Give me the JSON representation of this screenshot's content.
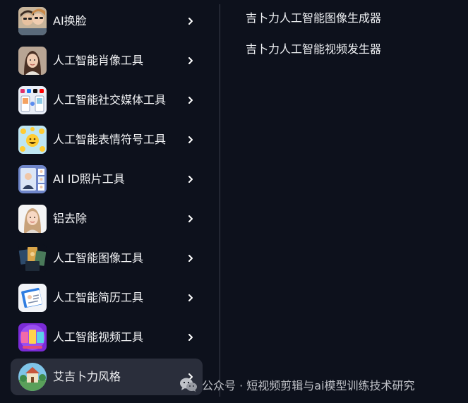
{
  "menu": {
    "items": [
      {
        "label": "AI换脸",
        "icon": "face-swap-thumbnail-icon"
      },
      {
        "label": "人工智能肖像工具",
        "icon": "portrait-thumbnail-icon"
      },
      {
        "label": "人工智能社交媒体工具",
        "icon": "social-media-thumbnail-icon"
      },
      {
        "label": "人工智能表情符号工具",
        "icon": "emoji-thumbnail-icon"
      },
      {
        "label": "AI ID照片工具",
        "icon": "id-photo-thumbnail-icon"
      },
      {
        "label": "铝去除",
        "icon": "removal-thumbnail-icon"
      },
      {
        "label": "人工智能图像工具",
        "icon": "image-tools-thumbnail-icon"
      },
      {
        "label": "人工智能简历工具",
        "icon": "resume-thumbnail-icon"
      },
      {
        "label": "人工智能视频工具",
        "icon": "video-tools-thumbnail-icon"
      },
      {
        "label": "艾吉卜力风格",
        "icon": "ghibli-style-thumbnail-icon"
      }
    ],
    "active_index": 9
  },
  "submenu": {
    "items": [
      {
        "label": "吉卜力人工智能图像生成器"
      },
      {
        "label": "吉卜力人工智能视频发生器"
      }
    ]
  },
  "watermark": {
    "text": "公众号 · 短视频剪辑与ai模型训练技术研究",
    "icon": "wechat-logo-icon"
  },
  "colors": {
    "background": "#0d111c",
    "active_item": "#2a2e3b",
    "divider": "#3a3f4c",
    "text": "#f2f3f5"
  }
}
